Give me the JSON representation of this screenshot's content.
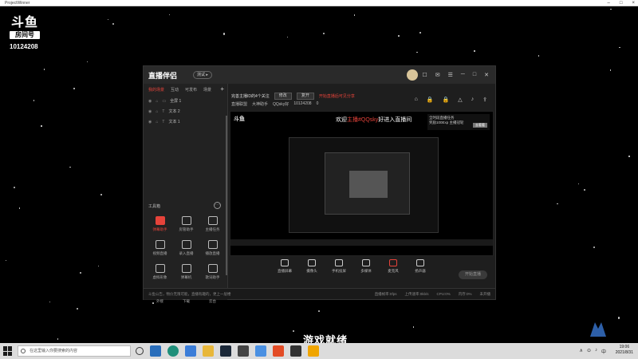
{
  "projector": {
    "title": "ProjectWinner",
    "buttons": [
      "–",
      "□",
      "×"
    ]
  },
  "overlay": {
    "logo_text": "斗鱼",
    "logo_tag": "房间号",
    "room_number": "10124208",
    "subtitle": "游戏就绪"
  },
  "app": {
    "logo": "直播伴侣",
    "version_badge": "测试 ▸",
    "head_icons": [
      "☐",
      "✉",
      "☰",
      "─",
      "□",
      "✕"
    ],
    "left_tabs": [
      "我的场景",
      "互动",
      "可发布",
      "场景"
    ],
    "add_label": "+",
    "scenes": [
      {
        "label": "全屏 1"
      },
      {
        "label": "文本 2"
      },
      {
        "label": "文本 1"
      }
    ],
    "tools_title": "工具箱",
    "tools_more": "···",
    "tools": [
      {
        "label": "弹幕助手",
        "active": true
      },
      {
        "label": "房管助手",
        "active": false
      },
      {
        "label": "主播任务",
        "active": false
      },
      {
        "label": "视频直播",
        "active": false
      },
      {
        "label": "录入直播",
        "active": false
      },
      {
        "label": "播放直播",
        "active": false
      },
      {
        "label": "虚拟形象",
        "active": false
      },
      {
        "label": "弹幕机",
        "active": false
      },
      {
        "label": "歌词助手",
        "active": false
      },
      {
        "label": "外接",
        "active": false
      },
      {
        "label": "下载",
        "active": false
      },
      {
        "label": "云台",
        "active": false
      }
    ],
    "info_text": "完善主播ID的4个关注",
    "info_btn1": "修改",
    "info_btn2": "复开",
    "info_red": "开始直播后可见分享",
    "info2": [
      "直播联盟",
      "大神助手",
      "QQsky好",
      "10124208",
      "0"
    ],
    "right_icons": [
      "⌂",
      "🔒",
      "🔒",
      "△",
      "♪",
      "⇪"
    ],
    "preview": {
      "logo": "斗鱼",
      "banner_line1": "全时段直播任务",
      "banner_line2": "奖励100Exp 主播冠轮",
      "banner_btn": "去看看",
      "welcome_prefix": "欢迎",
      "welcome_name": "主播#QQsky",
      "welcome_suffix": "好进入直播间"
    },
    "bottom_tools": [
      {
        "label": "直播屏幕"
      },
      {
        "label": "摄像头"
      },
      {
        "label": "手机投屏"
      },
      {
        "label": "多媒体"
      },
      {
        "label": "麦克风",
        "red": true
      },
      {
        "label": "扬声器"
      }
    ],
    "start_btn": "开始直播",
    "status_left": "斗鱼公告，物价无限可能，直播有趣的，更上一层楼",
    "status_right": [
      "直播帧率:0fps",
      "上传速率:0kb/s",
      "CPU:0%",
      "内存:0%",
      "未开播"
    ]
  },
  "taskbar": {
    "search_placeholder": "在这里输入你要搜索的内容",
    "tray": [
      "∧",
      "⊙",
      "♪",
      "中"
    ],
    "time": "19:06",
    "date": "2021/8/31"
  },
  "colors": {
    "accent": "#e6433a",
    "panel": "#222222",
    "taskbar": "#dcdcdc"
  }
}
